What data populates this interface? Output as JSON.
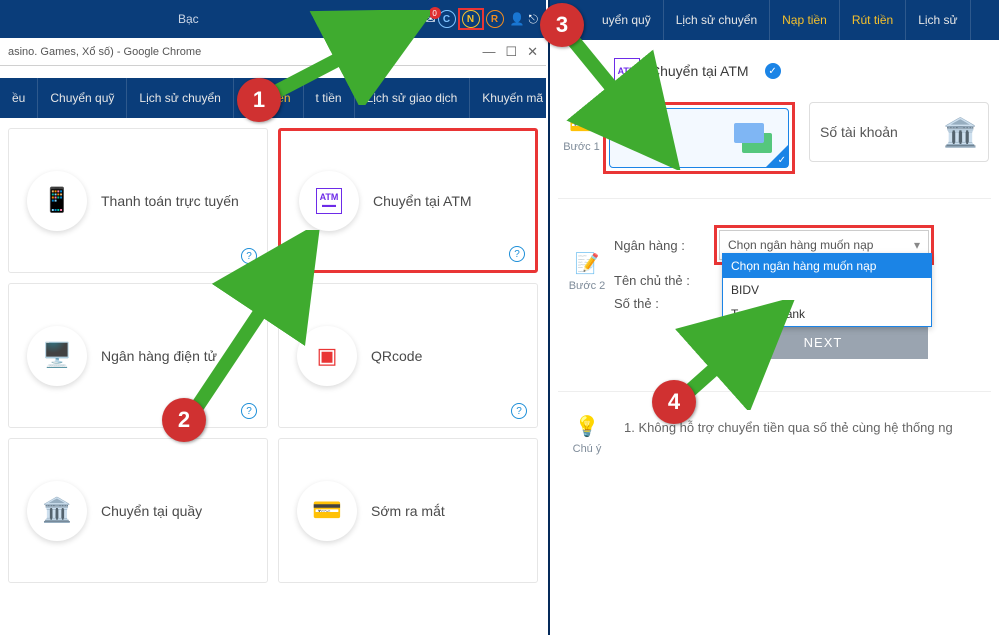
{
  "topbar": {
    "level": "Bạc",
    "mail_count": "0",
    "icon_c": "C",
    "icon_n": "N",
    "icon_r": "R"
  },
  "chrome": {
    "title": "asino. Games, Xổ số) - Google Chrome",
    "min": "—",
    "max": "☐",
    "close": "✕"
  },
  "nav_left": {
    "item0": "ều",
    "item1": "Chuyển quỹ",
    "item2": "Lịch sử chuyển",
    "item3": "Nạp tiền",
    "item4": "t tiền",
    "item5": "Lịch sử giao dịch",
    "item6": "Khuyến mã"
  },
  "cards": {
    "c0": "Thanh toán trực tuyến",
    "c1": "Chuyển tại ATM",
    "c2": "Ngân hàng điện tử",
    "c3": "QRcode",
    "c4": "Chuyển tại quầy",
    "c5": "Sớm ra mắt"
  },
  "nav_right": {
    "item0": "uyển quỹ",
    "item1": "Lịch sử chuyển",
    "item2": "Nạp tiền",
    "item3": "Rút tiền",
    "item4": "Lịch sử"
  },
  "step1": {
    "label": "Bước 1",
    "title": "Chuyển tại ATM",
    "choice_card": "Số thẻ",
    "choice_acct": "Số tài khoản"
  },
  "step2": {
    "label": "Bước 2",
    "bank_lbl": "Ngân hàng :",
    "holder_lbl": "Tên chủ thẻ :",
    "cardno_lbl": "Số thẻ :",
    "select_placeholder": "Chọn ngân hàng muốn nạp",
    "opt0": "Chọn ngân hàng muốn nạp",
    "opt1": "BIDV",
    "opt2": "Techcombank",
    "next": "NEXT"
  },
  "note": {
    "label": "Chú ý",
    "text": "1.  Không hỗ trợ chuyển tiền qua số thẻ cùng hệ thống ng"
  },
  "callouts": {
    "c1": "1",
    "c2": "2",
    "c3": "3",
    "c4": "4"
  }
}
